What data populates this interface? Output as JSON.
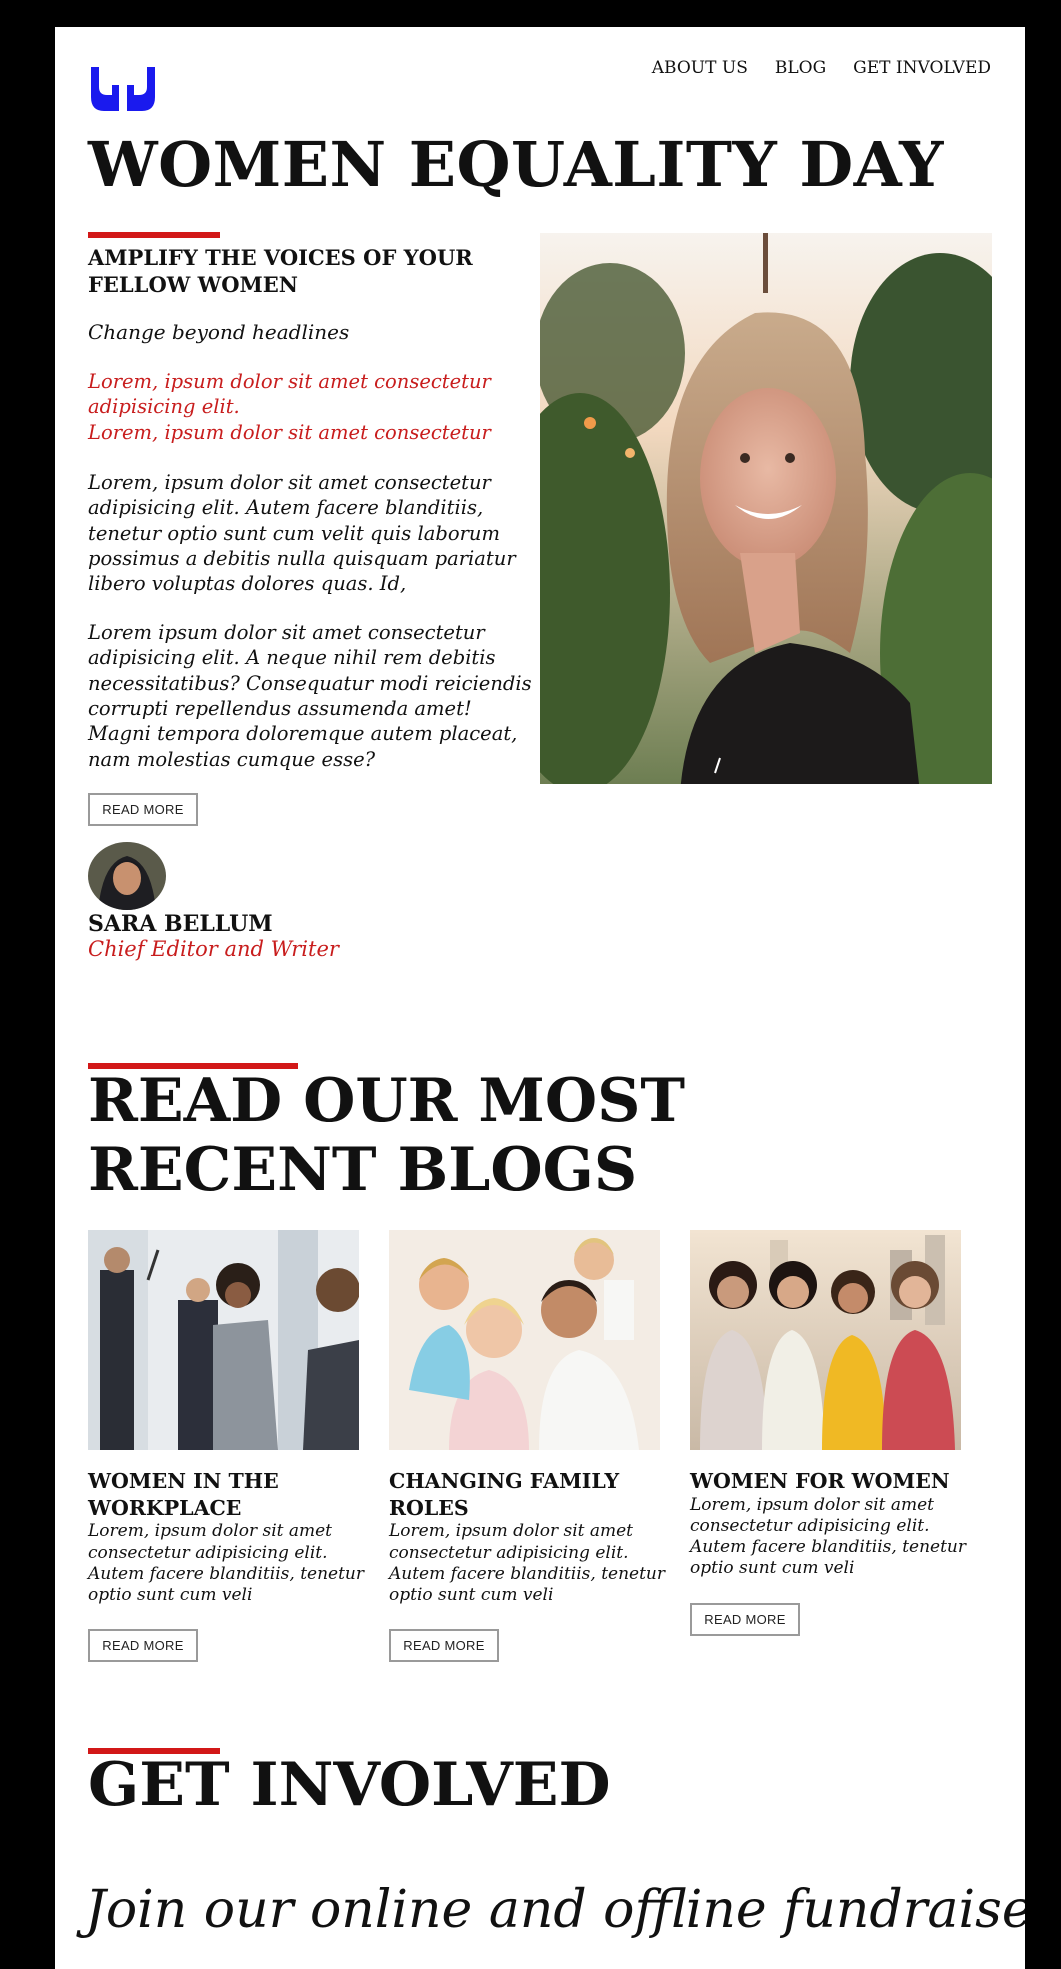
{
  "nav": {
    "items": [
      "ABOUT US",
      "BLOG",
      "GET INVOLVED"
    ]
  },
  "hero": {
    "title": "WOMEN EQUALITY DAY",
    "subheading": "AMPLIFY THE VOICES OF YOUR FELLOW WOMEN",
    "tagline": "Change beyond headlines",
    "red_lines": [
      "Lorem, ipsum dolor sit amet consectetur adipisicing elit.",
      "Lorem, ipsum dolor sit amet consectetur"
    ],
    "paragraph_1": "Lorem, ipsum dolor sit amet consectetur adipisicing elit. Autem facere blanditiis, tenetur optio sunt cum velit quis laborum possimus a debitis nulla quisquam pariatur libero voluptas dolores quas. Id,",
    "paragraph_2": "Lorem ipsum dolor sit amet consectetur adipisicing elit. A neque nihil rem debitis necessitatibus? Consequatur modi reiciendis corrupti repellendus assumenda amet! Magni tempora doloremque autem placeat, nam molestias cumque esse?",
    "read_more": "READ MORE"
  },
  "author": {
    "name": "SARA BELLUM",
    "role": "Chief Editor and Writer"
  },
  "blogs": {
    "title": "READ OUR MOST RECENT BLOGS",
    "cards": [
      {
        "title": "WOMEN IN THE WORKPLACE",
        "text": "Lorem, ipsum dolor sit amet consectetur adipisicing elit. Autem facere blanditiis, tenetur optio sunt cum veli",
        "button": "READ MORE"
      },
      {
        "title": "CHANGING FAMILY ROLES",
        "text": "Lorem, ipsum dolor sit amet consectetur adipisicing elit. Autem facere blanditiis, tenetur optio sunt cum veli",
        "button": "READ MORE"
      },
      {
        "title": "WOMEN FOR WOMEN",
        "text": "Lorem, ipsum dolor sit amet consectetur adipisicing elit. Autem facere blanditiis, tenetur optio sunt cum veli",
        "button": "READ MORE"
      }
    ]
  },
  "get_involved": {
    "title": "GET INVOLVED",
    "subtitle": "Join our online and offline fundraisers"
  },
  "colors": {
    "accent_red": "#d21818",
    "logo_blue": "#1a1aee",
    "page_bg": "#000000"
  },
  "icons": {
    "logo": "hands-icon"
  }
}
